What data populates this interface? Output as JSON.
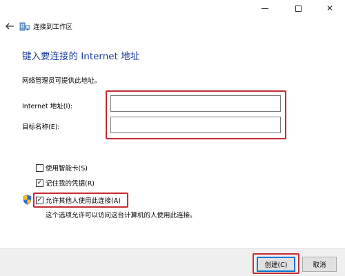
{
  "window": {
    "minimize_glyph": "",
    "maximize_glyph": "",
    "close_glyph": "✕"
  },
  "header": {
    "title": "连接到工作区"
  },
  "main": {
    "heading": "键入要连接的 Internet 地址",
    "description": "网络管理员可提供此地址。",
    "internet_address_label": "Internet 地址(I):",
    "internet_address_value": "",
    "destination_name_label": "目标名称(E):",
    "destination_name_value": ""
  },
  "options": {
    "use_smart_card": {
      "label": "使用智能卡(S)",
      "checked": false
    },
    "remember_credentials": {
      "label": "记住我的凭据(R)",
      "checked": true
    },
    "allow_others": {
      "label": "允许其他人使用此连接(A)",
      "checked": true
    },
    "allow_others_note": "这个选项允许可以访问这台计算机的人使用此连接。"
  },
  "footer": {
    "create_label": "创建(C)",
    "cancel_label": "取消"
  },
  "colors": {
    "heading": "#1b3d99",
    "highlight": "#c62b33",
    "default_button_border": "#0078d7"
  },
  "icons": {
    "back": "back-arrow-icon",
    "wizard": "network-workplace-icon",
    "shield": "uac-shield-icon",
    "checkmark": "✓"
  }
}
